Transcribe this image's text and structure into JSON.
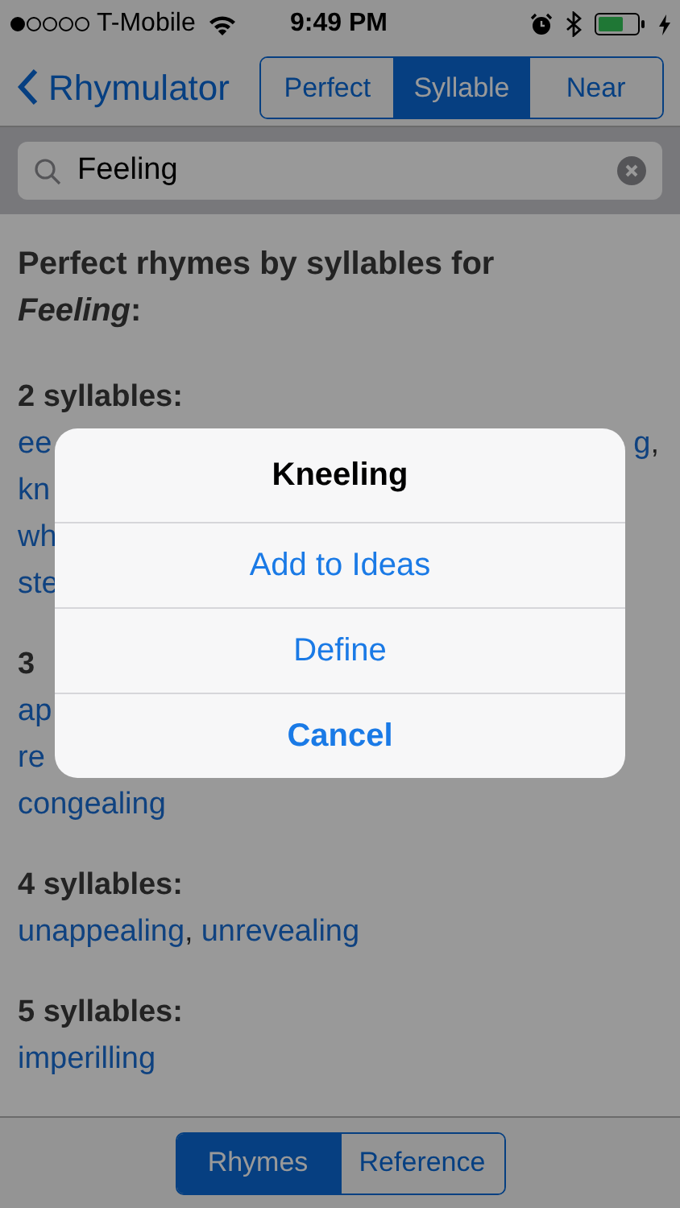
{
  "status_bar": {
    "carrier": "T-Mobile",
    "time": "9:49 PM"
  },
  "nav": {
    "back": "Rhymulator",
    "segments": [
      {
        "label": "Perfect",
        "selected": false
      },
      {
        "label": "Syllable",
        "selected": true
      },
      {
        "label": "Near",
        "selected": false
      }
    ]
  },
  "search": {
    "value": "Feeling"
  },
  "results": {
    "title": "Perfect rhymes by syllables for *Feeling*:",
    "groups": [
      {
        "heading": "2 syllables:",
        "lines": [
          {
            "left": [
              {
                "kind": "word",
                "text": "ee"
              }
            ],
            "right": [
              {
                "kind": "word",
                "text": "g"
              },
              {
                "kind": "punct",
                "text": ","
              }
            ]
          },
          {
            "left": [
              {
                "kind": "word",
                "text": "kn"
              }
            ]
          },
          {
            "left": [
              {
                "kind": "word",
                "text": "wh"
              }
            ]
          },
          {
            "left": [
              {
                "kind": "word",
                "text": "ste"
              }
            ]
          }
        ]
      },
      {
        "heading": "3",
        "lines": [
          {
            "left": [
              {
                "kind": "word",
                "text": "ap"
              }
            ]
          },
          {
            "left": [
              {
                "kind": "word",
                "text": "re"
              }
            ]
          },
          {
            "left": [
              {
                "kind": "word",
                "text": "congealing"
              }
            ]
          }
        ]
      },
      {
        "heading": "4 syllables:",
        "lines": [
          {
            "left": [
              {
                "kind": "word",
                "text": "unappealing"
              },
              {
                "kind": "punct",
                "text": ","
              },
              {
                "kind": "word",
                "text": "unrevealing"
              }
            ]
          }
        ]
      },
      {
        "heading": "5 syllables:",
        "lines": [
          {
            "left": [
              {
                "kind": "word",
                "text": "imperilling"
              }
            ]
          }
        ]
      }
    ]
  },
  "alert": {
    "title": "Kneeling",
    "actions": [
      {
        "label": "Add to Ideas",
        "kind": "default"
      },
      {
        "label": "Define",
        "kind": "default"
      },
      {
        "label": "Cancel",
        "kind": "cancel"
      }
    ]
  },
  "bottom_tabs": [
    {
      "label": "Rhymes",
      "selected": true
    },
    {
      "label": "Reference",
      "selected": false
    }
  ]
}
